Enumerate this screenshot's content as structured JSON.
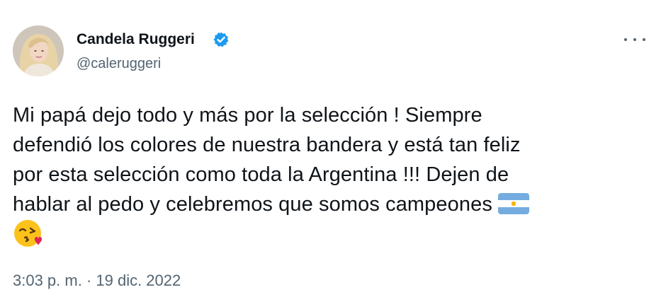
{
  "tweet": {
    "author": {
      "name": "Candela Ruggeri",
      "handle": "@caleruggeri",
      "verified": true,
      "avatar_icon": "profile-photo"
    },
    "more_icon": "more-horizontal-icon",
    "text_lines": [
      "Mi papá dejo todo y más por la selección ! Siempre",
      "defendió los colores de nuestra bandera y está tan feliz",
      "por esta selección como toda la Argentina !!! Dejen de",
      "hablar al pedo y celebremos que somos campeones"
    ],
    "emojis": [
      "argentina-flag",
      "face-blowing-a-kiss"
    ],
    "timestamp": "3:03 p. m. · 19 dic. 2022"
  },
  "colors": {
    "text": "#0f1419",
    "secondary": "#536471",
    "verified": "#1d9bf0",
    "flag_blue": "#74acdf",
    "flag_sun": "#f6b40e"
  }
}
